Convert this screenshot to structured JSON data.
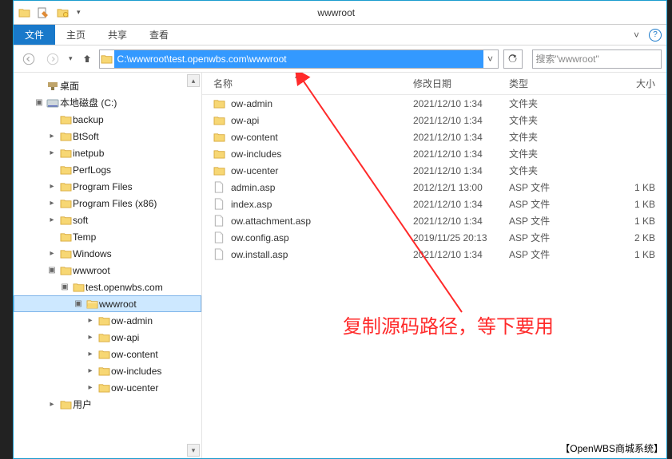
{
  "title": "wwwroot",
  "ribbon": {
    "file": "文件",
    "tabs": [
      "主页",
      "共享",
      "查看"
    ]
  },
  "addressbar": {
    "path": "C:\\wwwroot\\test.openwbs.com\\wwwroot"
  },
  "search": {
    "placeholder": "搜索\"wwwroot\""
  },
  "columns": {
    "name": "名称",
    "date": "修改日期",
    "type": "类型",
    "size": "大小"
  },
  "sidebar": [
    {
      "indent": 1,
      "icon": "desktop",
      "label": "桌面",
      "twisty": ""
    },
    {
      "indent": 1,
      "icon": "disk",
      "label": "本地磁盘 (C:)",
      "twisty": "▣"
    },
    {
      "indent": 2,
      "icon": "folder",
      "label": "backup",
      "twisty": ""
    },
    {
      "indent": 2,
      "icon": "folder",
      "label": "BtSoft",
      "twisty": "▸"
    },
    {
      "indent": 2,
      "icon": "folder",
      "label": "inetpub",
      "twisty": "▸"
    },
    {
      "indent": 2,
      "icon": "folder",
      "label": "PerfLogs",
      "twisty": ""
    },
    {
      "indent": 2,
      "icon": "folder",
      "label": "Program Files",
      "twisty": "▸"
    },
    {
      "indent": 2,
      "icon": "folder",
      "label": "Program Files (x86)",
      "twisty": "▸"
    },
    {
      "indent": 2,
      "icon": "folder",
      "label": "soft",
      "twisty": "▸"
    },
    {
      "indent": 2,
      "icon": "folder",
      "label": "Temp",
      "twisty": ""
    },
    {
      "indent": 2,
      "icon": "folder",
      "label": "Windows",
      "twisty": "▸"
    },
    {
      "indent": 2,
      "icon": "folder",
      "label": "wwwroot",
      "twisty": "▣"
    },
    {
      "indent": 3,
      "icon": "folder",
      "label": "test.openwbs.com",
      "twisty": "▣"
    },
    {
      "indent": 4,
      "icon": "folder-open",
      "label": "wwwroot",
      "twisty": "▣",
      "selected": true
    },
    {
      "indent": 5,
      "icon": "folder",
      "label": "ow-admin",
      "twisty": "▸"
    },
    {
      "indent": 5,
      "icon": "folder",
      "label": "ow-api",
      "twisty": "▸"
    },
    {
      "indent": 5,
      "icon": "folder",
      "label": "ow-content",
      "twisty": "▸"
    },
    {
      "indent": 5,
      "icon": "folder",
      "label": "ow-includes",
      "twisty": "▸"
    },
    {
      "indent": 5,
      "icon": "folder",
      "label": "ow-ucenter",
      "twisty": "▸"
    },
    {
      "indent": 2,
      "icon": "folder",
      "label": "用户",
      "twisty": "▸"
    }
  ],
  "rows": [
    {
      "icon": "folder",
      "name": "ow-admin",
      "date": "2021/12/10 1:34",
      "type": "文件夹",
      "size": ""
    },
    {
      "icon": "folder",
      "name": "ow-api",
      "date": "2021/12/10 1:34",
      "type": "文件夹",
      "size": ""
    },
    {
      "icon": "folder",
      "name": "ow-content",
      "date": "2021/12/10 1:34",
      "type": "文件夹",
      "size": ""
    },
    {
      "icon": "folder",
      "name": "ow-includes",
      "date": "2021/12/10 1:34",
      "type": "文件夹",
      "size": ""
    },
    {
      "icon": "folder",
      "name": "ow-ucenter",
      "date": "2021/12/10 1:34",
      "type": "文件夹",
      "size": ""
    },
    {
      "icon": "file",
      "name": "admin.asp",
      "date": "2012/12/1 13:00",
      "type": "ASP 文件",
      "size": "1 KB"
    },
    {
      "icon": "file",
      "name": "index.asp",
      "date": "2021/12/10 1:34",
      "type": "ASP 文件",
      "size": "1 KB"
    },
    {
      "icon": "file",
      "name": "ow.attachment.asp",
      "date": "2021/12/10 1:34",
      "type": "ASP 文件",
      "size": "1 KB"
    },
    {
      "icon": "file",
      "name": "ow.config.asp",
      "date": "2019/11/25 20:13",
      "type": "ASP 文件",
      "size": "2 KB"
    },
    {
      "icon": "file",
      "name": "ow.install.asp",
      "date": "2021/12/10 1:34",
      "type": "ASP 文件",
      "size": "1 KB"
    }
  ],
  "annotation": "复制源码路径，等下要用",
  "watermark": "【OpenWBS商城系统】"
}
